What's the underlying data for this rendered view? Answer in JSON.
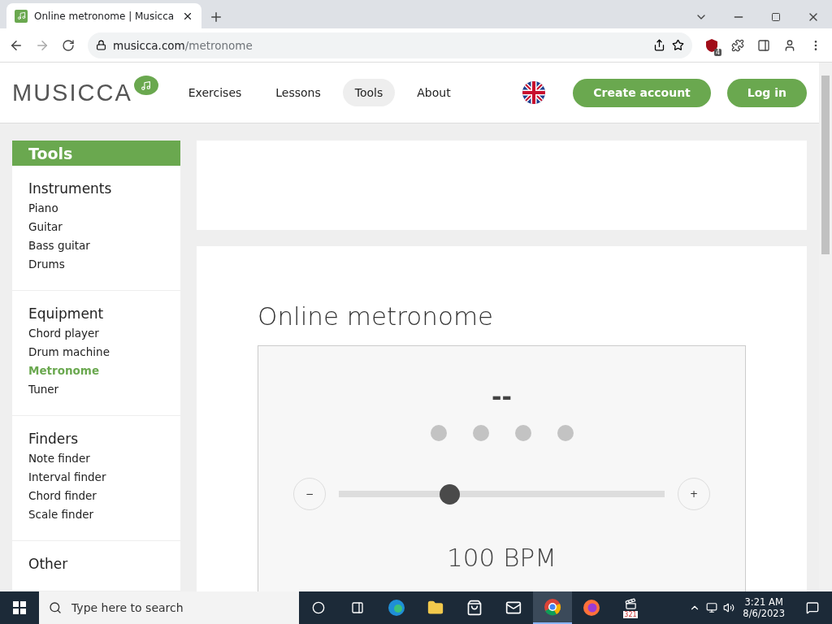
{
  "browser": {
    "tab_title": "Online metronome | Musicca",
    "url_host": "musicca.com",
    "url_path": "/metronome",
    "extension_badge": "4"
  },
  "site": {
    "logo": "MUSICCA",
    "nav": [
      {
        "label": "Exercises",
        "selected": false
      },
      {
        "label": "Lessons",
        "selected": false
      },
      {
        "label": "Tools",
        "selected": true
      },
      {
        "label": "About",
        "selected": false
      }
    ],
    "buttons": [
      "Create account",
      "Log in"
    ]
  },
  "sidebar": {
    "title": "Tools",
    "sections": [
      {
        "heading": "Instruments",
        "items": [
          {
            "label": "Piano",
            "selected": false
          },
          {
            "label": "Guitar",
            "selected": false
          },
          {
            "label": "Bass guitar",
            "selected": false
          },
          {
            "label": "Drums",
            "selected": false
          }
        ]
      },
      {
        "heading": "Equipment",
        "items": [
          {
            "label": "Chord player",
            "selected": false
          },
          {
            "label": "Drum machine",
            "selected": false
          },
          {
            "label": "Metronome",
            "selected": true
          },
          {
            "label": "Tuner",
            "selected": false
          }
        ]
      },
      {
        "heading": "Finders",
        "items": [
          {
            "label": "Note finder",
            "selected": false
          },
          {
            "label": "Interval finder",
            "selected": false
          },
          {
            "label": "Chord finder",
            "selected": false
          },
          {
            "label": "Scale finder",
            "selected": false
          }
        ]
      },
      {
        "heading": "Other"
      }
    ]
  },
  "main": {
    "title": "Online metronome",
    "metronome": {
      "beat_display": "--",
      "beats": [
        {
          "active": false
        },
        {
          "active": false
        },
        {
          "active": false
        },
        {
          "active": false
        }
      ],
      "minus": "−",
      "plus": "+",
      "tempo": {
        "level": 0.34
      },
      "bpm": "100 BPM"
    }
  },
  "taskbar": {
    "search_placeholder": "Type here to search",
    "app_label": "321",
    "time": "3:21 AM",
    "date": "8/6/2023"
  }
}
